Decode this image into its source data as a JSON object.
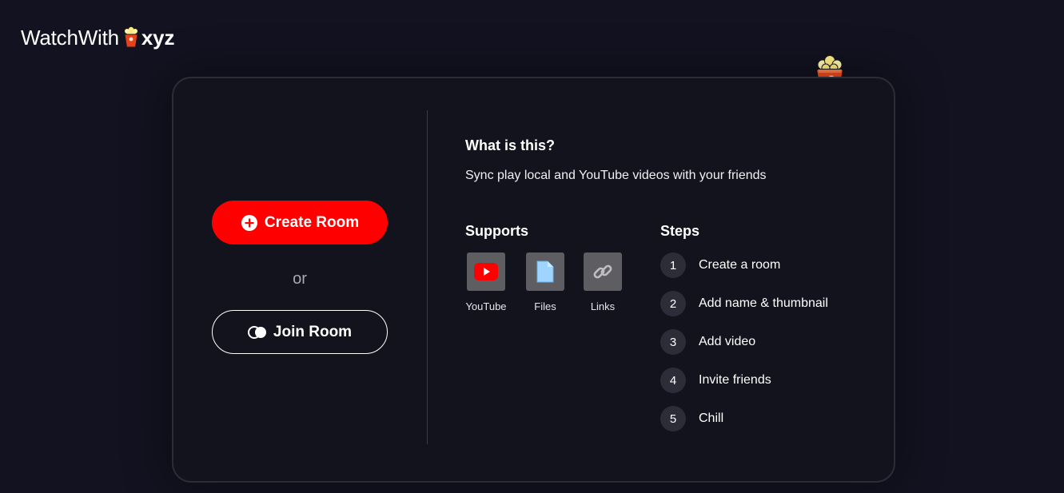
{
  "header": {
    "brand_prefix": "WatchWith",
    "brand_suffix": "xyz",
    "logo_icon": "popcorn-icon"
  },
  "actions": {
    "create_label": "Create Room",
    "create_icon": "plus-circle-icon",
    "or_label": "or",
    "join_label": "Join Room",
    "join_icon": "overlapping-circles-icon"
  },
  "about": {
    "title": "What is this?",
    "description": "Sync play local and YouTube videos with your friends"
  },
  "supports": {
    "title": "Supports",
    "items": [
      {
        "label": "YouTube",
        "icon": "youtube-icon"
      },
      {
        "label": "Files",
        "icon": "file-icon"
      },
      {
        "label": "Links",
        "icon": "link-icon"
      }
    ]
  },
  "steps": {
    "title": "Steps",
    "items": [
      {
        "num": "1",
        "label": "Create a room"
      },
      {
        "num": "2",
        "label": "Add name & thumbnail"
      },
      {
        "num": "3",
        "label": "Add video"
      },
      {
        "num": "4",
        "label": "Invite friends"
      },
      {
        "num": "5",
        "label": "Chill"
      }
    ]
  },
  "colors": {
    "background": "#121220",
    "card": "#13131e",
    "accent": "#ff0000",
    "step_badge": "#2d2d3a",
    "support_tile": "#5d5d62"
  }
}
